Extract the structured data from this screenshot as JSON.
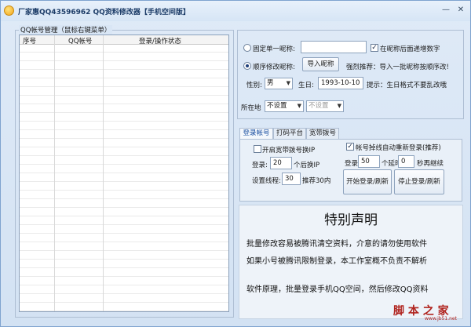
{
  "window": {
    "title": "厂家惠QQ43596962 QQ资料修改器【手机空间版】",
    "minimize_glyph": "—",
    "close_glyph": "✕"
  },
  "account_group": {
    "legend": "QQ帐号管理（鼠标右键菜单）",
    "columns": [
      "序号",
      "QQ帐号",
      "登录/操作状态"
    ]
  },
  "nickname": {
    "fixed_label": "固定单一昵称:",
    "fixed_value": "",
    "append_digits_label": "在昵称后面递增数字",
    "append_digits_checked": true,
    "sequential_label": "顺序修改昵称:",
    "import_button": "导入昵称",
    "recommend_text": "强烈推荐：导入一批昵称按顺序改!",
    "mode": "sequential"
  },
  "profile": {
    "gender_label": "性别:",
    "gender_value": "男",
    "birthday_label": "生日:",
    "birthday_value": "1993-10-10",
    "birthday_hint": "提示：生日格式不要乱改哦",
    "location_label": "所在地",
    "location_value_1": "不设置",
    "location_value_2": "不设置"
  },
  "tabs": [
    "登录帐号",
    "打码平台",
    "宽带拨号"
  ],
  "login_panel": {
    "dialup_label": "开启宽带拨号换IP",
    "dialup_checked": false,
    "relogin_label": "帐号掉线自动重新登录(推荐)",
    "relogin_checked": true,
    "login_prefix": "登录:",
    "login_count": "20",
    "switch_ip_suffix": "个后换IP",
    "thread_label": "设置线程:",
    "thread_count": "30",
    "thread_suffix": "推荐30内",
    "login2_prefix": "登录",
    "login2_count": "50",
    "delay_label": "个延时",
    "delay_value": "0",
    "delay_suffix": "秒再继续",
    "start_button": "开始登录/刷新",
    "stop_button": "停止登录/刷新"
  },
  "notice": {
    "title": "特别声明",
    "lines": [
      "批量修改容易被腾讯清空资料，介意的请勿使用软件",
      "如果小号被腾讯限制登录，本工作室概不负责不解析",
      "软件原理，批量登录手机QQ空间，然后修改QQ资料"
    ]
  },
  "watermark": {
    "text": "脚 本 之 家",
    "url": "www.jb51.net"
  }
}
